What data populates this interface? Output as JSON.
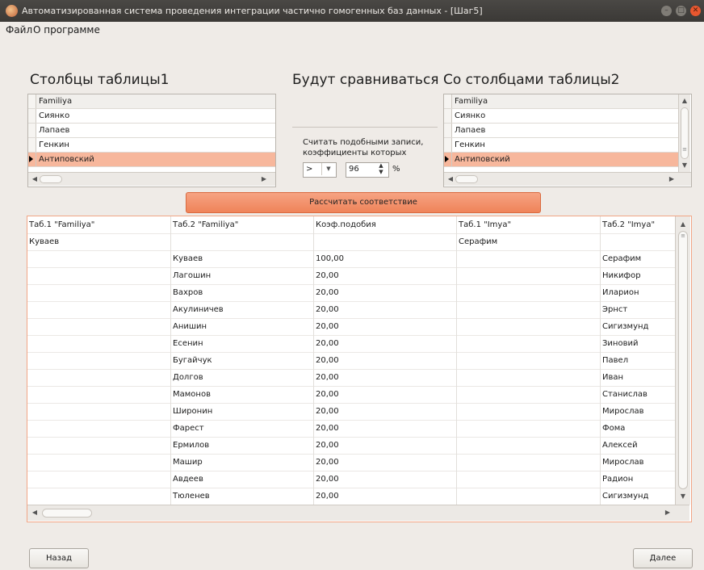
{
  "window": {
    "title": "Автоматизированная система проведения интеграции частично гомогенных баз данных - [Шаг5]"
  },
  "menu": {
    "file": "Файл",
    "about": "О программе"
  },
  "left": {
    "heading": "Столбцы таблицы1",
    "items": [
      "Familiya",
      "Сиянко",
      "Лапаев",
      "Генкин",
      "Антиповский"
    ]
  },
  "middle": {
    "heading": "Будут сравниваться",
    "condition_label": "Считать подобными записи, коэффициенты которых",
    "operator": ">",
    "coefficient": "96",
    "unit": "%"
  },
  "right": {
    "heading": "Со столбцами таблицы2",
    "items": [
      "Familiya",
      "Сиянко",
      "Лапаев",
      "Генкин",
      "Антиповский"
    ]
  },
  "calc_button": "Рассчитать соответствие",
  "grid": {
    "columns": [
      "Таб.1 \"Familiya\"",
      "Таб.2 \"Familiya\"",
      "Коэф.подобия",
      "Таб.1 \"Imya\"",
      "Таб.2 \"Imya\""
    ],
    "rows": [
      [
        "Куваев",
        "",
        "",
        "Серафим",
        ""
      ],
      [
        "",
        "Куваев",
        "100,00",
        "",
        "Серафим"
      ],
      [
        "",
        "Лагошин",
        "20,00",
        "",
        "Никифор"
      ],
      [
        "",
        "Вахров",
        "20,00",
        "",
        "Иларион"
      ],
      [
        "",
        "Акулиничев",
        "20,00",
        "",
        "Эрнст"
      ],
      [
        "",
        "Анишин",
        "20,00",
        "",
        "Сигизмунд"
      ],
      [
        "",
        "Есенин",
        "20,00",
        "",
        "Зиновий"
      ],
      [
        "",
        "Бугайчук",
        "20,00",
        "",
        "Павел"
      ],
      [
        "",
        "Долгов",
        "20,00",
        "",
        "Иван"
      ],
      [
        "",
        "Мамонов",
        "20,00",
        "",
        "Станислав"
      ],
      [
        "",
        "Широнин",
        "20,00",
        "",
        "Мирослав"
      ],
      [
        "",
        "Фарест",
        "20,00",
        "",
        "Фома"
      ],
      [
        "",
        "Ермилов",
        "20,00",
        "",
        "Алексей"
      ],
      [
        "",
        "Машир",
        "20,00",
        "",
        "Мирослав"
      ],
      [
        "",
        "Авдеев",
        "20,00",
        "",
        "Радион"
      ],
      [
        "",
        "Тюленев",
        "20,00",
        "",
        "Сигизмунд"
      ]
    ]
  },
  "nav": {
    "back": "Назад",
    "next": "Далее"
  },
  "colors": {
    "accent": "#ef8359",
    "selection": "#f7b79c",
    "close": "#e8572f"
  }
}
